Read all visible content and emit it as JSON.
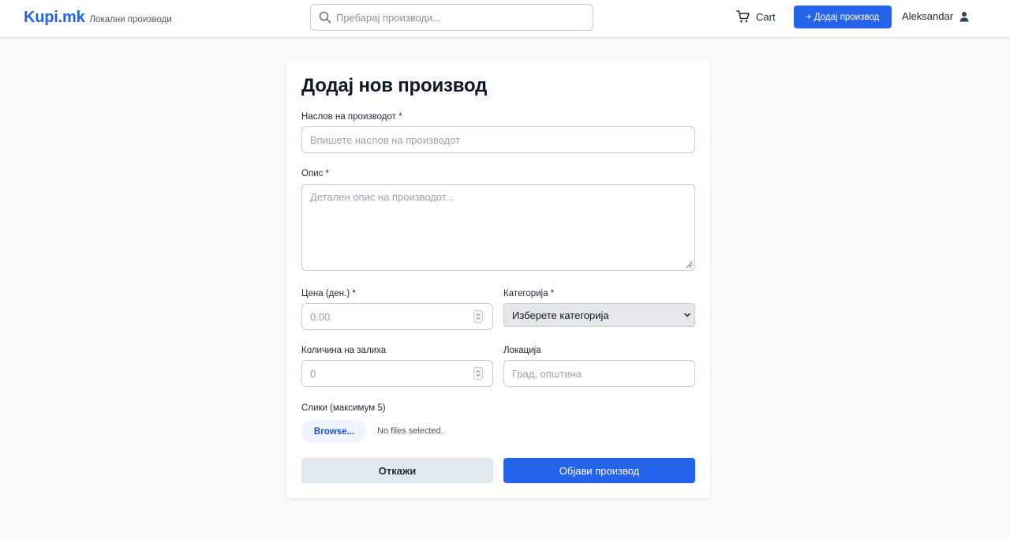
{
  "header": {
    "brand": "Kupi.mk",
    "tagline": "Локални производи",
    "search_placeholder": "Пребарај производи...",
    "cart_label": "Cart",
    "add_product_label": "+ Додај производ",
    "user_name": "Aleksandar"
  },
  "form": {
    "title": "Додај нов производ",
    "fields": {
      "product_title": {
        "label": "Наслов на производот *",
        "placeholder": "Впишете наслов на производот"
      },
      "description": {
        "label": "Опис *",
        "placeholder": "Детален опис на производот..."
      },
      "price": {
        "label": "Цена (ден.) *",
        "placeholder": "0.00"
      },
      "category": {
        "label": "Категорија *",
        "selected": "Изберете категорија"
      },
      "stock": {
        "label": "Количина на залиха",
        "placeholder": "0"
      },
      "location": {
        "label": "Локација",
        "placeholder": "Град, општина"
      },
      "images": {
        "label": "Слики (максимум 5)",
        "browse_label": "Browse...",
        "status": "No files selected."
      }
    },
    "cancel_label": "Откажи",
    "submit_label": "Објави производ"
  },
  "colors": {
    "brand": "#2563eb",
    "background": "#f8f9fb",
    "cancel_bg": "#e2e8f0",
    "select_bg": "#e5e7eb"
  },
  "icons": {
    "search": "search-icon",
    "cart": "cart-icon",
    "user": "user-icon",
    "select": "chevron-down-icon"
  }
}
